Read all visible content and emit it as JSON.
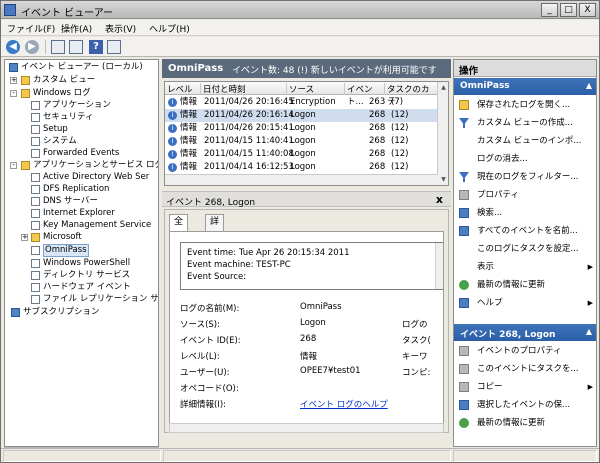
{
  "window": {
    "title": "イベント ビューアー",
    "minimize": "_",
    "maximize": "□",
    "close": "X"
  },
  "menu": {
    "file": "ファイル(F)",
    "action": "操作(A)",
    "view": "表示(V)",
    "help": "ヘルプ(H)"
  },
  "tree": {
    "items": [
      {
        "label": "イベント ビューアー (ローカル)",
        "expander": "",
        "icon": "event-viewer-icon"
      },
      {
        "label": "カスタム ビュー",
        "expander": "+",
        "icon": "folder-icon"
      },
      {
        "label": "Windows ログ",
        "expander": "-",
        "icon": "folder-icon"
      },
      {
        "label": "アプリケーション",
        "expander": "",
        "icon": "log-icon"
      },
      {
        "label": "セキュリティ",
        "expander": "",
        "icon": "log-icon"
      },
      {
        "label": "Setup",
        "expander": "",
        "icon": "log-icon"
      },
      {
        "label": "システム",
        "expander": "",
        "icon": "log-icon"
      },
      {
        "label": "Forwarded Events",
        "expander": "",
        "icon": "log-icon"
      },
      {
        "label": "アプリケーションとサービス ログ",
        "expander": "-",
        "icon": "folder-icon"
      },
      {
        "label": "Active Directory Web Ser",
        "expander": "",
        "icon": "log-icon"
      },
      {
        "label": "DFS Replication",
        "expander": "",
        "icon": "log-icon"
      },
      {
        "label": "DNS サーバー",
        "expander": "",
        "icon": "log-icon"
      },
      {
        "label": "Internet Explorer",
        "expander": "",
        "icon": "log-icon"
      },
      {
        "label": "Key Management Service",
        "expander": "",
        "icon": "log-icon"
      },
      {
        "label": "Microsoft",
        "expander": "+",
        "icon": "folder-icon"
      },
      {
        "label": "OmniPass",
        "expander": "",
        "icon": "log-icon",
        "selected": true
      },
      {
        "label": "Windows PowerShell",
        "expander": "",
        "icon": "log-icon"
      },
      {
        "label": "ディレクトリ サービス",
        "expander": "",
        "icon": "log-icon"
      },
      {
        "label": "ハードウェア イベント",
        "expander": "",
        "icon": "log-icon"
      },
      {
        "label": "ファイル レプリケーション サー",
        "expander": "",
        "icon": "log-icon"
      },
      {
        "label": "サブスクリプション",
        "expander": "",
        "icon": "subscription-icon"
      }
    ]
  },
  "middle": {
    "log_name": "OmniPass",
    "event_count_text": "イベント数: 48 (!) 新しいイベントが利用可能です",
    "columns": [
      "レベル",
      "日付と時刻",
      "ソース",
      "イベント...",
      "タスクのカテ"
    ],
    "rows": [
      {
        "level": "情報",
        "datetime": "2011/04/26 20:16:45",
        "source": "Encryption",
        "event_id": "263",
        "task": "(7)"
      },
      {
        "level": "情報",
        "datetime": "2011/04/26 20:16:14",
        "source": "Logon",
        "event_id": "268",
        "task": "(12)",
        "selected": true
      },
      {
        "level": "情報",
        "datetime": "2011/04/26 20:15:41",
        "source": "Logon",
        "event_id": "268",
        "task": "(12)"
      },
      {
        "level": "情報",
        "datetime": "2011/04/15 11:40:41",
        "source": "Logon",
        "event_id": "268",
        "task": "(12)"
      },
      {
        "level": "情報",
        "datetime": "2011/04/15 11:40:08",
        "source": "Logon",
        "event_id": "268",
        "task": "(12)"
      },
      {
        "level": "情報",
        "datetime": "2011/04/14 16:12:53",
        "source": "Logon",
        "event_id": "268",
        "task": "(12)"
      }
    ]
  },
  "detail": {
    "title": "イベント 268, Logon",
    "close": "x",
    "tabs": [
      "全般",
      "詳細"
    ],
    "message": [
      "Event time: Tue Apr 26 20:15:34 2011",
      "Event machine: TEST-PC",
      "Event Source:"
    ],
    "props": {
      "log_name_label": "ログの名前(M):",
      "log_name_value": "OmniPass",
      "source_label": "ソース(S):",
      "source_value": "Logon",
      "source_right_label": "ログの",
      "event_id_label": "イベント ID(E):",
      "event_id_value": "268",
      "event_id_right_label": "タスク(",
      "level_label": "レベル(L):",
      "level_value": "情報",
      "level_right_label": "キーワ",
      "user_label": "ユーザー(U):",
      "user_value": "OPEE7¥test01",
      "user_right_label": "コンピ:",
      "opcode_label": "オペコード(O):",
      "detail_label": "詳細情報(I):",
      "detail_link": "イベント ログのヘルプ"
    }
  },
  "actions": {
    "header": "操作",
    "section1_title": "OmniPass",
    "section1_items": [
      {
        "label": "保存されたログを開く...",
        "icon": "open-folder-icon",
        "arrow": ""
      },
      {
        "label": "カスタム ビューの作成...",
        "icon": "filter-icon",
        "arrow": ""
      },
      {
        "label": "カスタム ビューのインポ...",
        "icon": "none-icon",
        "arrow": ""
      },
      {
        "label": "ログの消去...",
        "icon": "none-icon",
        "arrow": ""
      },
      {
        "label": "現在のログをフィルター...",
        "icon": "filter-icon",
        "arrow": ""
      },
      {
        "label": "プロパティ",
        "icon": "properties-icon",
        "arrow": ""
      },
      {
        "label": "検索...",
        "icon": "find-icon",
        "arrow": ""
      },
      {
        "label": "すべてのイベントを名前...",
        "icon": "save-icon",
        "arrow": ""
      },
      {
        "label": "このログにタスクを設定...",
        "icon": "none-icon",
        "arrow": ""
      },
      {
        "label": "表示",
        "icon": "none-icon",
        "arrow": "▶"
      },
      {
        "label": "最新の情報に更新",
        "icon": "refresh-icon",
        "arrow": ""
      },
      {
        "label": "ヘルプ",
        "icon": "help-icon",
        "arrow": "▶"
      }
    ],
    "section2_title": "イベント 268, Logon",
    "section2_items": [
      {
        "label": "イベントのプロパティ",
        "icon": "properties-icon",
        "arrow": ""
      },
      {
        "label": "このイベントにタスクを...",
        "icon": "task-icon",
        "arrow": ""
      },
      {
        "label": "コピー",
        "icon": "copy-icon",
        "arrow": "▶"
      },
      {
        "label": "選択したイベントの保...",
        "icon": "save-icon",
        "arrow": ""
      },
      {
        "label": "最新の情報に更新",
        "icon": "refresh-icon",
        "arrow": ""
      }
    ],
    "section_tri": "▲"
  }
}
